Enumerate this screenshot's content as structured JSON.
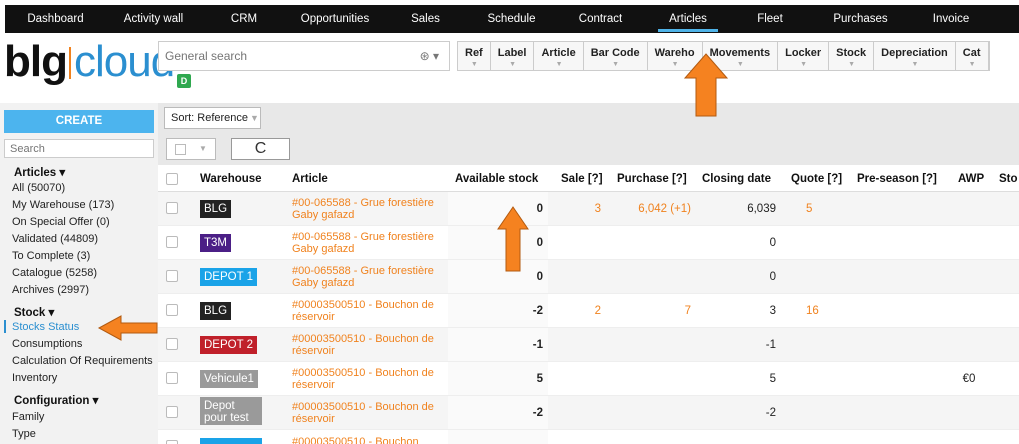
{
  "topnav": {
    "items": [
      {
        "label": "Dashboard"
      },
      {
        "label": "Activity wall"
      },
      {
        "label": "CRM"
      },
      {
        "label": "Opportunities"
      },
      {
        "label": "Sales"
      },
      {
        "label": "Schedule"
      },
      {
        "label": "Contract"
      },
      {
        "label": "Articles"
      },
      {
        "label": "Fleet"
      },
      {
        "label": "Purchases"
      },
      {
        "label": "Invoice"
      }
    ],
    "active": "Articles"
  },
  "logo": {
    "part1": "blg",
    "part2": "cloud"
  },
  "search": {
    "placeholder": "General search",
    "badge": "D"
  },
  "columns_filter": [
    "Ref",
    "Label",
    "Article",
    "Bar Code",
    "Wareho",
    "Movements",
    "Locker",
    "Stock",
    "Depreciation",
    "Cat"
  ],
  "sidebar": {
    "create_label": "CREATE",
    "search_placeholder": "Search",
    "sections": [
      {
        "title": "Articles ▾",
        "items": [
          "All (50070)",
          "My Warehouse (173)",
          "On Special Offer (0)",
          "Validated (44809)",
          "To Complete (3)",
          "Catalogue (5258)",
          "Archives (2997)"
        ]
      },
      {
        "title": "Stock ▾",
        "items": [
          "Stocks Status",
          "Consumptions",
          "Calculation Of Requirements",
          "Inventory"
        ]
      },
      {
        "title": "Configuration ▾",
        "items": [
          "Family",
          "Type"
        ]
      }
    ],
    "active_item": "Stocks Status"
  },
  "toolbar": {
    "sort_label": "Sort: Reference",
    "refresh_glyph": "C"
  },
  "table": {
    "headers": {
      "warehouse": "Warehouse",
      "article": "Article",
      "available": "Available stock",
      "sale": "Sale [?]",
      "purchase": "Purchase [?]",
      "closing": "Closing date",
      "quote": "Quote [?]",
      "preseason": "Pre-season [?]",
      "awp": "AWP",
      "sto": "Sto"
    },
    "rows": [
      {
        "warehouse": "BLG",
        "wh_color": "#222222",
        "article": "#00-065588 - Grue forestière Gaby gafazd",
        "available": "0",
        "sale": "3",
        "purchase": "6,042 (+1)",
        "closing": "6,039",
        "quote": "5",
        "awp": ""
      },
      {
        "warehouse": "T3M",
        "wh_color": "#4b1f86",
        "article": "#00-065588 - Grue forestière Gaby gafazd",
        "available": "0",
        "sale": "",
        "purchase": "",
        "closing": "0",
        "quote": "",
        "awp": ""
      },
      {
        "warehouse": "DEPOT 1",
        "wh_color": "#1aa3e8",
        "article": "#00-065588 - Grue forestière Gaby gafazd",
        "available": "0",
        "sale": "",
        "purchase": "",
        "closing": "0",
        "quote": "",
        "awp": ""
      },
      {
        "warehouse": "BLG",
        "wh_color": "#222222",
        "article": "#00003500510 - Bouchon de réservoir",
        "available": "-2",
        "sale": "2",
        "purchase": "7",
        "closing": "3",
        "quote": "16",
        "awp": ""
      },
      {
        "warehouse": "DEPOT 2",
        "wh_color": "#c0202a",
        "article": "#00003500510 - Bouchon de réservoir",
        "available": "-1",
        "sale": "",
        "purchase": "",
        "closing": "-1",
        "quote": "",
        "awp": ""
      },
      {
        "warehouse": "Vehicule1",
        "wh_color": "#9a9a9a",
        "article": "#00003500510 - Bouchon de réservoir",
        "available": "5",
        "sale": "",
        "purchase": "",
        "closing": "5",
        "quote": "",
        "awp": "€0"
      },
      {
        "warehouse": "Depot pour test",
        "wh_color": "#9a9a9a",
        "article": "#00003500510 - Bouchon de réservoir",
        "available": "-2",
        "sale": "",
        "purchase": "",
        "closing": "-2",
        "quote": "",
        "awp": ""
      },
      {
        "warehouse": "",
        "wh_color": "#1aa3e8",
        "article": "#00003500510 - Bouchon",
        "available": "",
        "sale": "",
        "purchase": "",
        "closing": "",
        "quote": "",
        "awp": ""
      }
    ]
  },
  "annotations": {
    "arrow_color": "#f58220"
  }
}
